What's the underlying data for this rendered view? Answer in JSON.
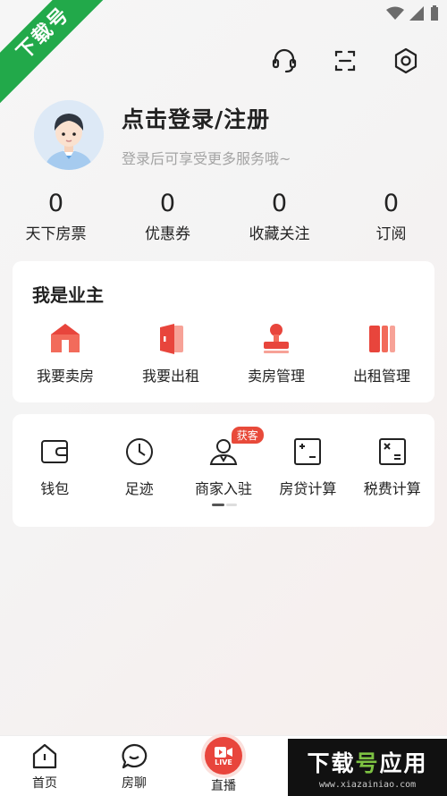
{
  "watermark_corner": "下载号",
  "header": {
    "icons": [
      "headset-icon",
      "scan-icon",
      "settings-icon"
    ]
  },
  "profile": {
    "title": "点击登录/注册",
    "subtitle": "登录后可享受更多服务哦~"
  },
  "stats": [
    {
      "value": "0",
      "label": "天下房票"
    },
    {
      "value": "0",
      "label": "优惠券"
    },
    {
      "value": "0",
      "label": "收藏关注"
    },
    {
      "value": "0",
      "label": "订阅"
    }
  ],
  "owner": {
    "title": "我是业主",
    "items": [
      {
        "label": "我要卖房",
        "icon": "house-icon"
      },
      {
        "label": "我要出租",
        "icon": "door-icon"
      },
      {
        "label": "卖房管理",
        "icon": "stamp-icon"
      },
      {
        "label": "出租管理",
        "icon": "book-icon"
      }
    ]
  },
  "tools": {
    "items": [
      {
        "label": "钱包",
        "icon": "wallet-icon"
      },
      {
        "label": "足迹",
        "icon": "clock-icon"
      },
      {
        "label": "商家入驻",
        "icon": "person-icon",
        "badge": "获客"
      },
      {
        "label": "房贷计算",
        "icon": "calculator-icon"
      },
      {
        "label": "税费计算",
        "icon": "tax-calculator-icon"
      }
    ]
  },
  "tabbar": {
    "items": [
      {
        "label": "首页",
        "icon": "home-icon"
      },
      {
        "label": "房聊",
        "icon": "chat-icon"
      },
      {
        "label": "直播",
        "icon": "live-icon",
        "badge_text": "LIVE"
      }
    ]
  },
  "watermark_bottom": {
    "big_a": "下载",
    "big_b": "号",
    "big_c": "应用",
    "url": "www.xiazainiao.com"
  },
  "colors": {
    "accent": "#e8453c",
    "ribbon": "#22a94a"
  }
}
